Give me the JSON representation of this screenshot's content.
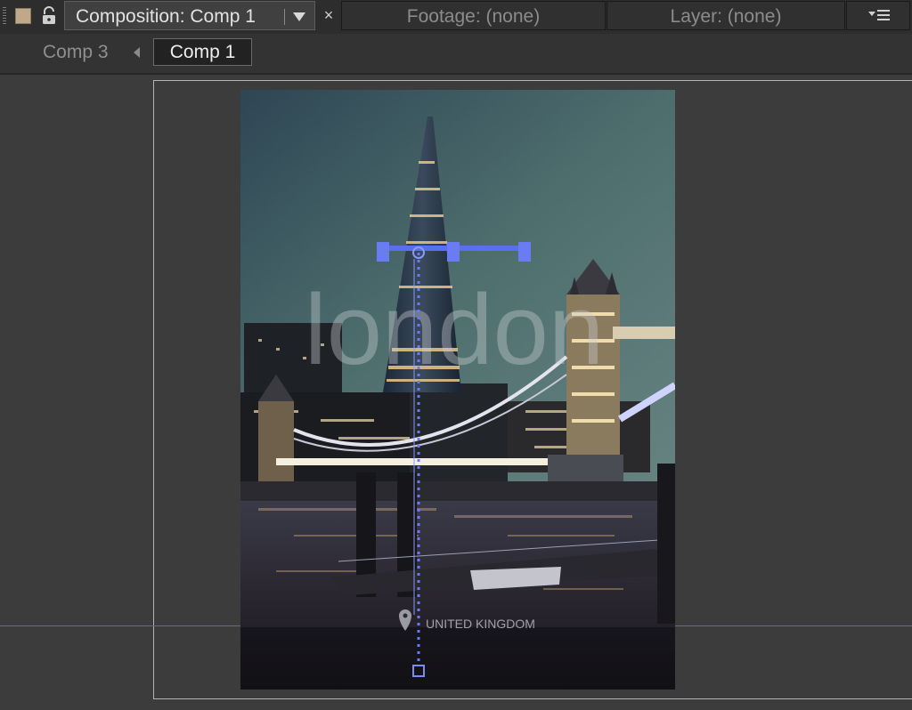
{
  "tabs": {
    "composition_label": "Composition: Comp 1",
    "footage_label": "Footage: (none)",
    "layer_label": "Layer: (none)",
    "close_glyph": "×"
  },
  "breadcrumbs": {
    "items": [
      "Comp 3",
      "Comp 1"
    ],
    "active": "Comp 1"
  },
  "comp": {
    "watermark_text": "london",
    "location_text": "UNITED KINGDOM",
    "label_color": "#bfa98a",
    "guide_color": "#5a6ff0"
  }
}
